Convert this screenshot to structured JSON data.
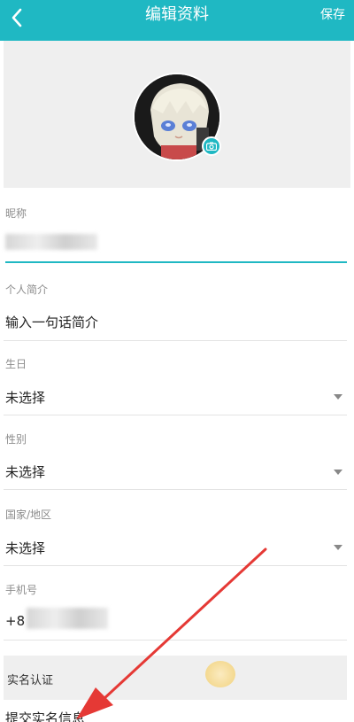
{
  "header": {
    "title": "编辑资料",
    "save_label": "保存",
    "bg_color": "#1fb8c3"
  },
  "avatar": {
    "icon": "camera-icon"
  },
  "fields": {
    "nickname": {
      "label": "昵称",
      "value": ""
    },
    "bio": {
      "label": "个人简介",
      "placeholder": "输入一句话简介"
    },
    "birthday": {
      "label": "生日",
      "value": "未选择"
    },
    "gender": {
      "label": "性别",
      "value": "未选择"
    },
    "region": {
      "label": "国家/地区",
      "value": "未选择"
    },
    "phone": {
      "label": "手机号",
      "value": "+8"
    }
  },
  "verification": {
    "section_title": "实名认证",
    "action_label": "提交实名信息"
  },
  "annotation": {
    "color": "#e53935"
  }
}
